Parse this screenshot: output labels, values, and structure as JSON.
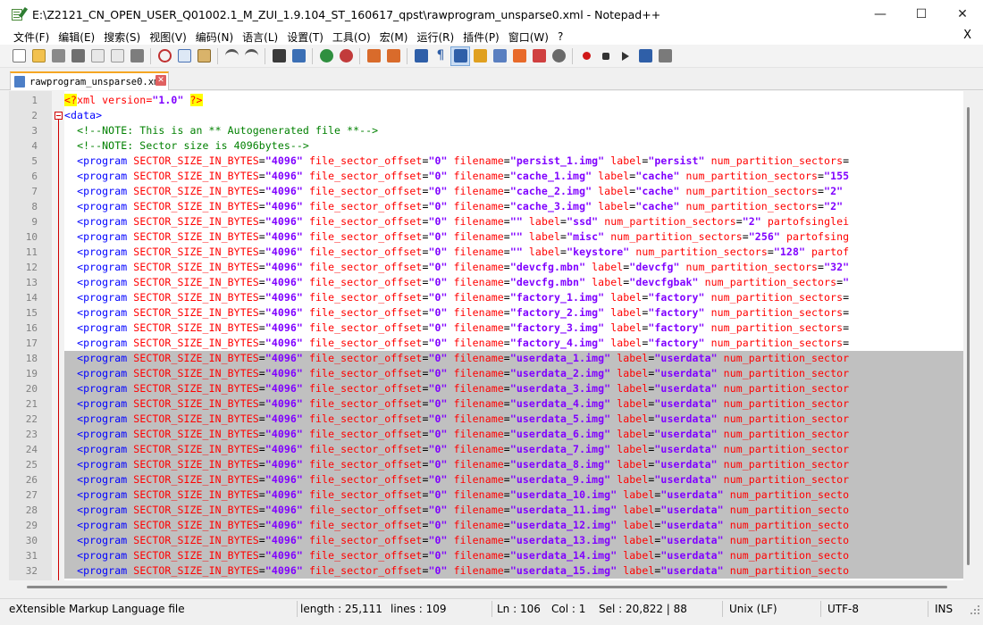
{
  "window": {
    "title": "E:\\Z2121_CN_OPEN_USER_Q01002.1_M_ZUI_1.9.104_ST_160617_qpst\\rawprogram_unsparse0.xml - Notepad++",
    "controls": {
      "minimize": "—",
      "maximize": "☐",
      "close": "✕"
    }
  },
  "menu": {
    "items": [
      "文件(F)",
      "编辑(E)",
      "搜索(S)",
      "视图(V)",
      "编码(N)",
      "语言(L)",
      "设置(T)",
      "工具(O)",
      "宏(M)",
      "运行(R)",
      "插件(P)",
      "窗口(W)",
      "?"
    ],
    "close": "X"
  },
  "toolbar": {
    "icons": [
      "new-file-icon",
      "open-file-icon",
      "save-icon",
      "save-all-icon",
      "close-icon",
      "close-all-icon",
      "print-icon",
      "cut-icon",
      "copy-icon",
      "paste-icon",
      "undo-icon",
      "redo-icon",
      "find-icon",
      "replace-icon",
      "zoom-in-icon",
      "zoom-out-icon",
      "sync-vertical-icon",
      "sync-horizontal-icon",
      "word-wrap-icon",
      "show-all-chars-icon",
      "indent-guide-icon",
      "udl-icon",
      "doc-map-icon",
      "function-list-icon",
      "folder-workspace-icon",
      "monitoring-icon",
      "record-macro-icon",
      "stop-macro-icon",
      "play-macro-icon",
      "run-macro-multiple-icon",
      "save-macro-icon"
    ],
    "active_icon": "indent-guide-icon"
  },
  "tab": {
    "label": "rawprogram_unsparse0.xml",
    "icon": "file-saved-icon"
  },
  "editor": {
    "selection_start_line": 18,
    "lines": [
      {
        "n": "1",
        "kind": "pi",
        "text": "<?xml version=\"1.0\" ?>"
      },
      {
        "n": "2",
        "kind": "tag",
        "indent": 0,
        "text": "<data>"
      },
      {
        "n": "3",
        "kind": "comment",
        "indent": 1,
        "text": "<!--NOTE: This is an ** Autogenerated file **-->"
      },
      {
        "n": "4",
        "kind": "comment",
        "indent": 1,
        "text": "<!--NOTE: Sector size is 4096bytes-->"
      },
      {
        "n": "5",
        "kind": "program",
        "file": "persist_1.img",
        "label": "persist",
        "tail": "num_partition_sectors="
      },
      {
        "n": "6",
        "kind": "program",
        "file": "cache_1.img",
        "label": "cache",
        "tail": "num_partition_sectors=\"155"
      },
      {
        "n": "7",
        "kind": "program",
        "file": "cache_2.img",
        "label": "cache",
        "tail": "num_partition_sectors=\"2\" "
      },
      {
        "n": "8",
        "kind": "program",
        "file": "cache_3.img",
        "label": "cache",
        "tail": "num_partition_sectors=\"2\" "
      },
      {
        "n": "9",
        "kind": "program",
        "file": "",
        "label": "ssd",
        "tail": "num_partition_sectors=\"2\" partofsinglei"
      },
      {
        "n": "10",
        "kind": "program",
        "file": "",
        "label": "misc",
        "tail": "num_partition_sectors=\"256\" partofsing"
      },
      {
        "n": "11",
        "kind": "program",
        "file": "",
        "label": "keystore",
        "tail": "num_partition_sectors=\"128\" partof"
      },
      {
        "n": "12",
        "kind": "program",
        "file": "devcfg.mbn",
        "label": "devcfg",
        "tail": "num_partition_sectors=\"32\""
      },
      {
        "n": "13",
        "kind": "program",
        "file": "devcfg.mbn",
        "label": "devcfgbak",
        "tail": "num_partition_sectors=\""
      },
      {
        "n": "14",
        "kind": "program",
        "file": "factory_1.img",
        "label": "factory",
        "tail": "num_partition_sectors="
      },
      {
        "n": "15",
        "kind": "program",
        "file": "factory_2.img",
        "label": "factory",
        "tail": "num_partition_sectors="
      },
      {
        "n": "16",
        "kind": "program",
        "file": "factory_3.img",
        "label": "factory",
        "tail": "num_partition_sectors="
      },
      {
        "n": "17",
        "kind": "program",
        "file": "factory_4.img",
        "label": "factory",
        "tail": "num_partition_sectors="
      },
      {
        "n": "18",
        "kind": "program",
        "file": "userdata_1.img",
        "label": "userdata",
        "tail": "num_partition_sector"
      },
      {
        "n": "19",
        "kind": "program",
        "file": "userdata_2.img",
        "label": "userdata",
        "tail": "num_partition_sector"
      },
      {
        "n": "20",
        "kind": "program",
        "file": "userdata_3.img",
        "label": "userdata",
        "tail": "num_partition_sector"
      },
      {
        "n": "21",
        "kind": "program",
        "file": "userdata_4.img",
        "label": "userdata",
        "tail": "num_partition_sector"
      },
      {
        "n": "22",
        "kind": "program",
        "file": "userdata_5.img",
        "label": "userdata",
        "tail": "num_partition_sector"
      },
      {
        "n": "23",
        "kind": "program",
        "file": "userdata_6.img",
        "label": "userdata",
        "tail": "num_partition_sector"
      },
      {
        "n": "24",
        "kind": "program",
        "file": "userdata_7.img",
        "label": "userdata",
        "tail": "num_partition_sector"
      },
      {
        "n": "25",
        "kind": "program",
        "file": "userdata_8.img",
        "label": "userdata",
        "tail": "num_partition_sector"
      },
      {
        "n": "26",
        "kind": "program",
        "file": "userdata_9.img",
        "label": "userdata",
        "tail": "num_partition_sector"
      },
      {
        "n": "27",
        "kind": "program",
        "file": "userdata_10.img",
        "label": "userdata",
        "tail": "num_partition_secto"
      },
      {
        "n": "28",
        "kind": "program",
        "file": "userdata_11.img",
        "label": "userdata",
        "tail": "num_partition_secto"
      },
      {
        "n": "29",
        "kind": "program",
        "file": "userdata_12.img",
        "label": "userdata",
        "tail": "num_partition_secto"
      },
      {
        "n": "30",
        "kind": "program",
        "file": "userdata_13.img",
        "label": "userdata",
        "tail": "num_partition_secto"
      },
      {
        "n": "31",
        "kind": "program",
        "file": "userdata_14.img",
        "label": "userdata",
        "tail": "num_partition_secto"
      },
      {
        "n": "32",
        "kind": "program",
        "file": "userdata_15.img",
        "label": "userdata",
        "tail": "num_partition_secto"
      }
    ],
    "program_prefix": {
      "tag": "<program",
      "sector_attr": "SECTOR_SIZE_IN_BYTES",
      "sector_val": "\"4096\"",
      "offset_attr": "file_sector_offset",
      "offset_val": "\"0\"",
      "filename_attr": "filename",
      "label_attr": "label"
    }
  },
  "status": {
    "filetype": "eXtensible Markup Language file",
    "length": "length : 25,111",
    "lines": "lines : 109",
    "ln": "Ln : 106",
    "col": "Col : 1",
    "sel": "Sel : 20,822 | 88",
    "eol": "Unix (LF)",
    "encoding": "UTF-8",
    "mode": "INS"
  },
  "colors": {
    "tag": "#0000ff",
    "attr": "#ff0000",
    "value": "#8000ff",
    "comment": "#008000",
    "selection": "#c0c0c0",
    "tab_accent": "#f5a623",
    "gutter": "#e4e4e4",
    "fold_marker": "#d00000"
  }
}
